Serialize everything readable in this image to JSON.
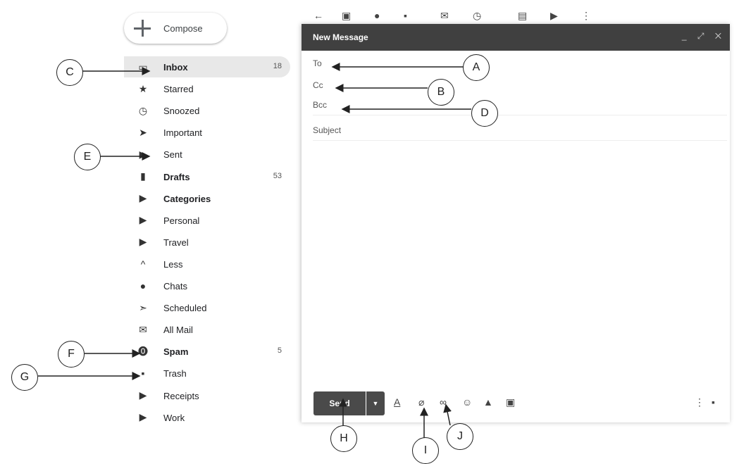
{
  "compose_button": {
    "label": "Compose"
  },
  "nav": [
    {
      "label": "Inbox",
      "count": "18",
      "icon": "inbox-icon",
      "bold": true,
      "active": true
    },
    {
      "label": "Starred",
      "count": "",
      "icon": "star-icon"
    },
    {
      "label": "Snoozed",
      "count": "",
      "icon": "clock-icon"
    },
    {
      "label": "Important",
      "count": "",
      "icon": "important-icon"
    },
    {
      "label": "Sent",
      "count": "",
      "icon": "send-icon"
    },
    {
      "label": "Drafts",
      "count": "53",
      "icon": "draft-icon",
      "bold": true
    },
    {
      "label": "Categories",
      "count": "",
      "icon": "label-icon",
      "bold": true
    },
    {
      "label": "Personal",
      "count": "",
      "icon": "label-icon"
    },
    {
      "label": "Travel",
      "count": "",
      "icon": "label-icon"
    },
    {
      "label": "Less",
      "count": "",
      "icon": "chevron-up-icon"
    },
    {
      "label": "Chats",
      "count": "",
      "icon": "chat-icon"
    },
    {
      "label": "Scheduled",
      "count": "",
      "icon": "scheduled-icon"
    },
    {
      "label": "All Mail",
      "count": "",
      "icon": "mail-icon"
    },
    {
      "label": "Spam",
      "count": "5",
      "icon": "spam-icon",
      "bold": true
    },
    {
      "label": "Trash",
      "count": "",
      "icon": "trash-icon"
    },
    {
      "label": "Receipts",
      "count": "",
      "icon": "label-icon"
    },
    {
      "label": "Work",
      "count": "",
      "icon": "label-icon"
    }
  ],
  "compose_window": {
    "title": "New Message",
    "to_label": "To",
    "cc_label": "Cc",
    "bcc_label": "Bcc",
    "subject_placeholder": "Subject",
    "send_label": "Send"
  },
  "callouts": [
    "A",
    "B",
    "C",
    "D",
    "E",
    "F",
    "G",
    "H",
    "I",
    "J"
  ]
}
